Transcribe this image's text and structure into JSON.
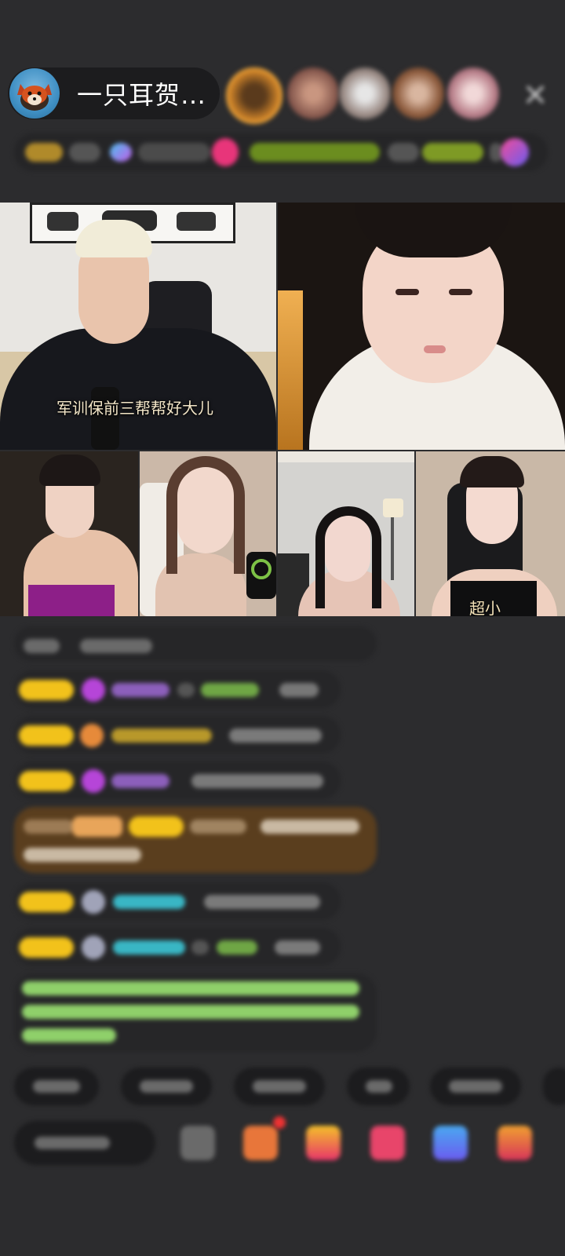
{
  "header": {
    "host_name": "一只耳贺…",
    "host_avatar_icon": "fox-cartoon-avatar",
    "viewer_avatars": [
      "viewer-1",
      "viewer-2",
      "viewer-3",
      "viewer-4",
      "viewer-5"
    ],
    "close_icon": "×"
  },
  "video": {
    "tile_1_caption": "军训保前三帮帮好大儿",
    "tile_7_tag": "超小"
  },
  "colors": {
    "background": "#2c2c2e",
    "badge_yellow": "#f2c21b",
    "name_purple": "#9a6cc9",
    "name_cyan": "#39b6c4",
    "system_green": "#8fd06a",
    "highlight_brown": "#5a3e1e"
  }
}
